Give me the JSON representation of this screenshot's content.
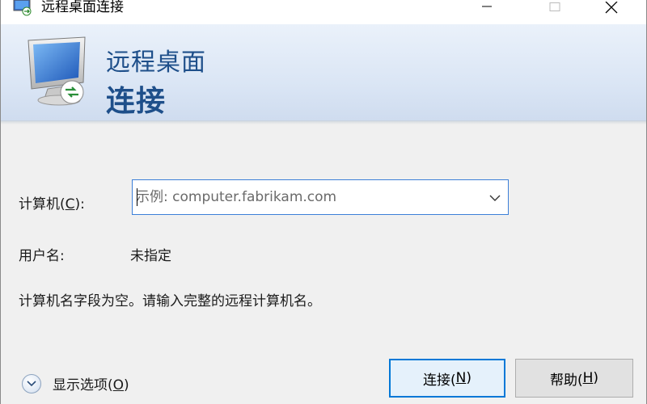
{
  "window": {
    "title": "远程桌面连接",
    "icon": "remote-desktop-icon"
  },
  "banner": {
    "line1": "远程桌面",
    "line2": "连接",
    "icon": "monitor-remote-icon"
  },
  "form": {
    "computer_label_prefix": "计算机(",
    "computer_label_key": "C",
    "computer_label_suffix": "):",
    "computer_placeholder": "示例: computer.fabrikam.com",
    "computer_value": "",
    "username_label": "用户名:",
    "username_value": "未指定",
    "message": "计算机名字段为空。请输入完整的远程计算机名。"
  },
  "footer": {
    "options_prefix": "显示选项(",
    "options_key": "O",
    "options_suffix": ")",
    "connect_prefix": "连接(",
    "connect_key": "N",
    "connect_suffix": ")",
    "help_prefix": "帮助(",
    "help_key": "H",
    "help_suffix": ")"
  },
  "colors": {
    "accent": "#0078d7",
    "banner_text": "#1e4f8a"
  }
}
